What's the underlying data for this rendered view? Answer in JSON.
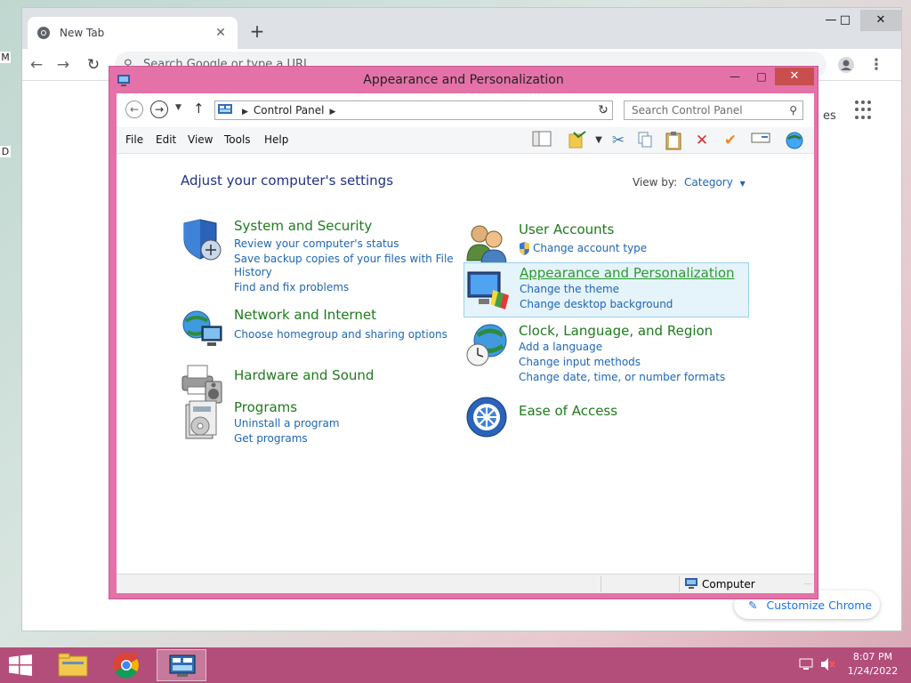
{
  "browser": {
    "tab_title": "New Tab",
    "tab_close": "✕",
    "new_tab": "+",
    "omnibox_placeholder": "Search Google or type a URL",
    "images_fragment": "es",
    "customize_label": "Customize Chrome"
  },
  "desktop": {
    "frag_a": "M",
    "frag_b": "D"
  },
  "control_panel": {
    "window_title": "Appearance and Personalization",
    "breadcrumb": "Control Panel",
    "search_placeholder": "Search Control Panel",
    "menu": [
      "File",
      "Edit",
      "View",
      "Tools",
      "Help"
    ],
    "heading": "Adjust your computer's settings",
    "view_by_label": "View by:",
    "view_by_value": "Category",
    "categories": [
      {
        "title": "System and Security",
        "links": [
          "Review your computer's status",
          "Save backup copies of your files with File",
          "History",
          "Find and fix problems"
        ],
        "icon": "shield-icon"
      },
      {
        "title": "Network and Internet",
        "links": [
          "Choose homegroup and sharing options"
        ],
        "icon": "network-globe-icon"
      },
      {
        "title": "Hardware and Sound",
        "links": [],
        "icon": "printer-speaker-icon"
      },
      {
        "title": "Programs",
        "links": [
          "Uninstall a program",
          "Get programs"
        ],
        "icon": "programs-box-icon"
      },
      {
        "title": "User Accounts",
        "links": [
          "Change account type"
        ],
        "icon": "users-icon"
      },
      {
        "title": "Appearance and Personalization",
        "links": [
          "Change the theme",
          "Change desktop background"
        ],
        "icon": "monitor-palette-icon",
        "selected": true
      },
      {
        "title": "Clock, Language, and Region",
        "links": [
          "Add a language",
          "Change input methods",
          "Change date, time, or number formats"
        ],
        "icon": "globe-clock-icon"
      },
      {
        "title": "Ease of Access",
        "links": [],
        "icon": "accessibility-icon"
      }
    ],
    "status_computer": "Computer"
  },
  "taskbar": {
    "time": "8:07 PM",
    "date": "1/24/2022"
  },
  "colors": {
    "accent_window": "#e472a8",
    "taskbar": "#b34d7a",
    "category_title": "#1e7a1e",
    "link": "#1e66b4",
    "heading": "#1e3287"
  }
}
